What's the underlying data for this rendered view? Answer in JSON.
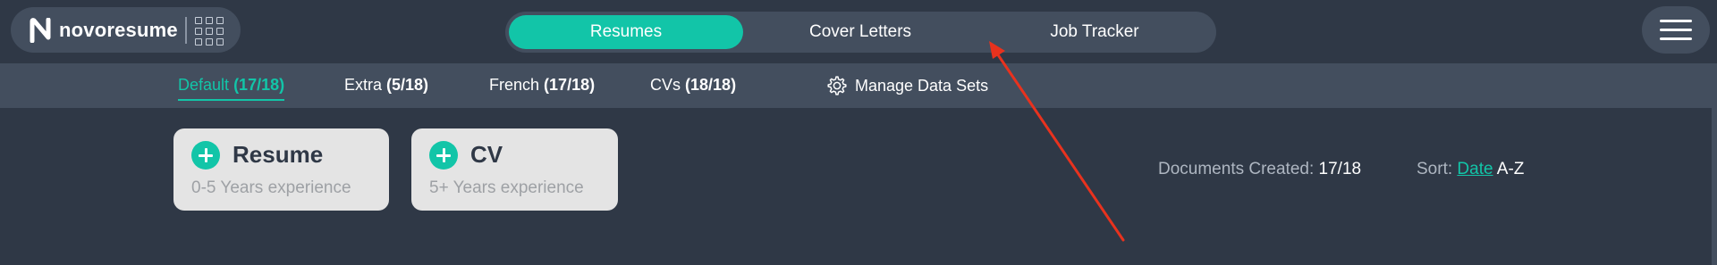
{
  "brand": {
    "logo_text": "novoresume",
    "logo_icon": "novoresume-n-logo",
    "apps_icon": "app-grid-icon"
  },
  "main_tabs": [
    {
      "label": "Resumes",
      "active": true
    },
    {
      "label": "Cover Letters",
      "active": false
    },
    {
      "label": "Job Tracker",
      "active": false
    }
  ],
  "menu": {
    "icon": "hamburger-menu-icon"
  },
  "data_sets": [
    {
      "name": "Default",
      "count": "(17/18)",
      "active": true
    },
    {
      "name": "Extra",
      "count": "(5/18)",
      "active": false
    },
    {
      "name": "French",
      "count": "(17/18)",
      "active": false
    },
    {
      "name": "CVs",
      "count": "(18/18)",
      "active": false
    }
  ],
  "manage": {
    "label": "Manage Data Sets",
    "icon": "gear-icon"
  },
  "create_cards": [
    {
      "title": "Resume",
      "subtitle": "0-5 Years experience",
      "icon": "plus-circle-icon"
    },
    {
      "title": "CV",
      "subtitle": "5+ Years experience",
      "icon": "plus-circle-icon"
    }
  ],
  "documents": {
    "label": "Documents Created:",
    "value": "17/18"
  },
  "sort": {
    "label": "Sort:",
    "field": "Date",
    "order": "A-Z"
  },
  "colors": {
    "accent": "#12c5a8",
    "background": "#2f3846",
    "panel": "#434e5e",
    "card": "#e4e4e4",
    "annotation_arrow": "#e8321e"
  }
}
